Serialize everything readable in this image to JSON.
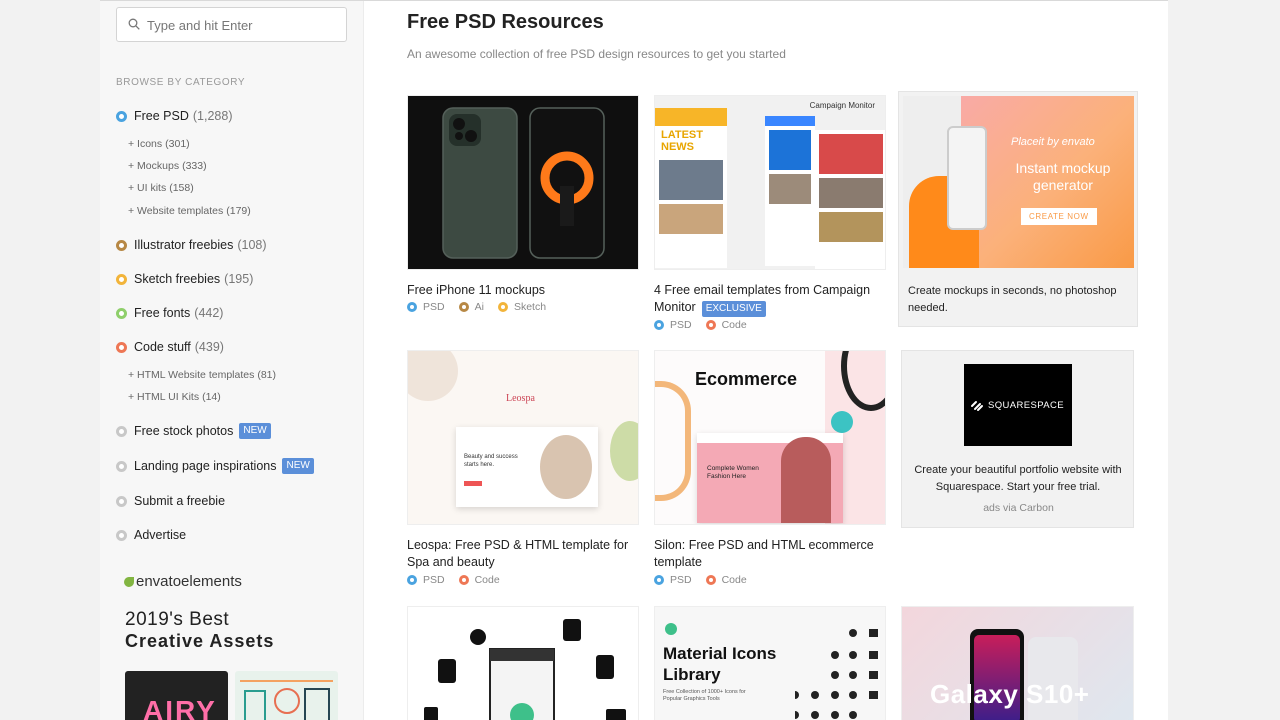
{
  "colors": {
    "psd": "#4aa3e0",
    "illustrator": "#b78845",
    "sketch": "#f2b43a",
    "fonts": "#8fcf6b",
    "code": "#ee7755",
    "neutral": "#c8c8c8",
    "badge": "#5b8fd9"
  },
  "sidebar": {
    "search": {
      "placeholder": "Type and hit Enter",
      "icon": "search-icon"
    },
    "browse_label": "BROWSE BY CATEGORY",
    "categories": [
      {
        "label": "Free PSD",
        "count": "(1,288)"
      },
      {
        "label": "Illustrator freebies",
        "count": "(108)"
      },
      {
        "label": "Sketch freebies",
        "count": "(195)"
      },
      {
        "label": "Free fonts",
        "count": "(442)"
      },
      {
        "label": "Code stuff",
        "count": "(439)"
      },
      {
        "label": "Free stock photos",
        "badge": "NEW"
      },
      {
        "label": "Landing page inspirations",
        "badge": "NEW"
      },
      {
        "label": "Submit a freebie"
      },
      {
        "label": "Advertise"
      }
    ],
    "psd_subs": [
      {
        "label": "+ Icons",
        "count": "(301)"
      },
      {
        "label": "+ Mockups",
        "count": "(333)"
      },
      {
        "label": "+ UI kits",
        "count": "(158)"
      },
      {
        "label": "+ Website templates",
        "count": "(179)"
      }
    ],
    "code_subs": [
      {
        "label": "+ HTML Website templates",
        "count": "(81)"
      },
      {
        "label": "+ HTML UI Kits",
        "count": "(14)"
      }
    ],
    "promo": {
      "brand": "envatoelements",
      "line1": "2019's Best",
      "line2": "Creative Assets",
      "thumb1_text": "AIRY"
    }
  },
  "main": {
    "title": "Free PSD Resources",
    "subtitle": "An awesome collection of free PSD design resources to get you started",
    "cards": [
      {
        "title": "Free iPhone 11 mockups",
        "tags": [
          "PSD",
          "Ai",
          "Sketch"
        ]
      },
      {
        "title": "4 Free email templates from Campaign Monitor",
        "badge": "EXCLUSIVE",
        "tags": [
          "PSD",
          "Code"
        ]
      },
      {
        "title": "Leospa: Free PSD & HTML template for Spa and beauty",
        "tags": [
          "PSD",
          "Code"
        ]
      },
      {
        "title": "Silon: Free PSD and HTML ecommerce template",
        "tags": [
          "PSD",
          "Code"
        ]
      }
    ],
    "placeit": {
      "brand": "Placeit by envato",
      "headline": "Instant mockup generator",
      "cta": "CREATE NOW",
      "text": "Create mockups in seconds, no photoshop needed."
    },
    "squarespace": {
      "logo": "SQUARESPACE",
      "text": "Create your beautiful portfolio website with Squarespace. Start your free trial.",
      "by": "ads via Carbon"
    },
    "thumb_text": {
      "campaign_monitor": "Campaign Monitor",
      "latest_news": "LATEST NEWS",
      "leospa": "Leospa",
      "leospa_hero": "Beauty and success starts here.",
      "ecommerce": "Ecommerce",
      "silon_hero": "Complete Women Fashion Here",
      "material": "Material Icons Library",
      "material_sub": "Free Collection of 1000+ Icons for Popular Graphics Tools",
      "galaxy": "Galaxy S10+"
    }
  }
}
